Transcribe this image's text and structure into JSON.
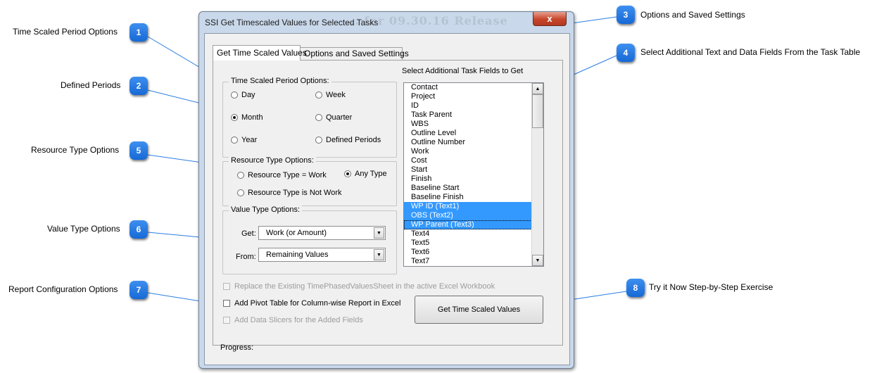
{
  "window": {
    "title": "SSI Get Timescaled Values for Selected Tasks",
    "ghost_text": "... for 09.30.16 Release",
    "close_label": "x"
  },
  "tabs": [
    {
      "label": "Get Time Scaled Values",
      "active": true
    },
    {
      "label": "Options and Saved Settings",
      "active": false
    }
  ],
  "period_group": {
    "label": "Time Scaled Period Options:",
    "options": [
      {
        "label": "Day",
        "checked": false
      },
      {
        "label": "Week",
        "checked": false
      },
      {
        "label": "Month",
        "checked": true
      },
      {
        "label": "Quarter",
        "checked": false
      },
      {
        "label": "Year",
        "checked": false
      },
      {
        "label": "Defined Periods",
        "checked": false
      }
    ]
  },
  "resource_group": {
    "label": "Resource Type Options:",
    "options": [
      {
        "label": "Resource Type = Work",
        "checked": false
      },
      {
        "label": "Any Type",
        "checked": true
      },
      {
        "label": "Resource Type is Not Work",
        "checked": false
      }
    ]
  },
  "value_group": {
    "label": "Value Type Options:",
    "get_label": "Get:",
    "get_value": "Work (or Amount)",
    "from_label": "From:",
    "from_value": "Remaining Values"
  },
  "fields": {
    "header": "Select Additional Task Fields to Get",
    "items": [
      {
        "label": "Contact",
        "selected": false
      },
      {
        "label": "Project",
        "selected": false
      },
      {
        "label": "ID",
        "selected": false
      },
      {
        "label": "Task Parent",
        "selected": false
      },
      {
        "label": "WBS",
        "selected": false
      },
      {
        "label": "Outline Level",
        "selected": false
      },
      {
        "label": "Outline Number",
        "selected": false
      },
      {
        "label": "Work",
        "selected": false
      },
      {
        "label": "Cost",
        "selected": false
      },
      {
        "label": "Start",
        "selected": false
      },
      {
        "label": "Finish",
        "selected": false
      },
      {
        "label": "Baseline Start",
        "selected": false
      },
      {
        "label": "Baseline Finish",
        "selected": false
      },
      {
        "label": "WP ID (Text1)",
        "selected": true
      },
      {
        "label": "OBS (Text2)",
        "selected": true
      },
      {
        "label": "WP Parent (Text3)",
        "selected": true,
        "focused": true
      },
      {
        "label": "Text4",
        "selected": false
      },
      {
        "label": "Text5",
        "selected": false
      },
      {
        "label": "Text6",
        "selected": false
      },
      {
        "label": "Text7",
        "selected": false
      }
    ]
  },
  "checkboxes": {
    "replace_sheet": {
      "label": "Replace the Existing TimePhasedValuesSheet in the active Excel Workbook",
      "checked": false,
      "enabled": false
    },
    "pivot_table": {
      "label": "Add Pivot Table for Column-wise Report in Excel",
      "checked": false,
      "enabled": true
    },
    "data_slicers": {
      "label": "Add Data Slicers for the Added Fields",
      "checked": false,
      "enabled": false
    }
  },
  "run_button": "Get Time Scaled Values",
  "progress_label": "Progress:",
  "callouts": [
    {
      "number": "1",
      "label": "Time Scaled Period Options"
    },
    {
      "number": "2",
      "label": "Defined Periods"
    },
    {
      "number": "3",
      "label": "Options and Saved Settings"
    },
    {
      "number": "4",
      "label": "Select Additional Text and Data Fields From the Task Table"
    },
    {
      "number": "5",
      "label": "Resource Type Options"
    },
    {
      "number": "6",
      "label": "Value Type Options"
    },
    {
      "number": "7",
      "label": "Report Configuration Options"
    },
    {
      "number": "8",
      "label": "Try it Now Step-by-Step Exercise"
    }
  ],
  "colors": {
    "callout_badge": "#1f74e0",
    "callout_line": "#2a7de1",
    "selection": "#3399ff",
    "window_frame": "#c9d8ea",
    "close_button": "#c6452a"
  }
}
